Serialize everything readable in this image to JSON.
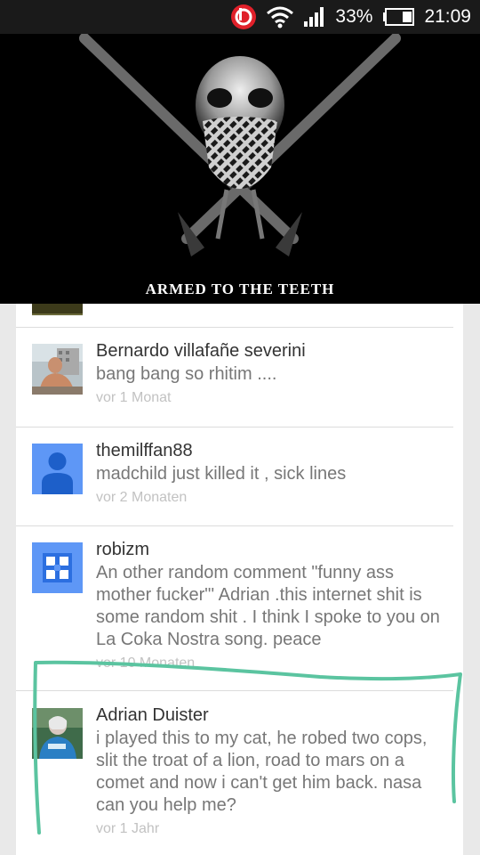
{
  "status_bar": {
    "battery": "33%",
    "time": "21:09",
    "icons": [
      "beats-icon",
      "wifi-icon",
      "signal-icon",
      "battery-icon"
    ]
  },
  "video": {
    "caption": "ARMED TO THE TEETH"
  },
  "comments": [
    {
      "author": "Bernardo villafañe severini",
      "text": "bang bang so rhitim ....",
      "time": "vor 1 Monat"
    },
    {
      "author": "themilffan88",
      "text": "madchild just killed it , sick lines",
      "time": "vor 2 Monaten"
    },
    {
      "author": "robizm",
      "text_lines": [
        "An other random comment \"funny ass",
        "mother fucker\"' Adrian .this internet shit is",
        "some random shit . I think I spoke to you on",
        "La Coka Nostra song. peace"
      ],
      "time": "vor 10 Monaten"
    },
    {
      "author": "Adrian Duister",
      "text_lines": [
        "i played this to my cat, he robed two cops,",
        "slit the troat of a lion, road to mars on a",
        "comet and now i can't get him back. nasa",
        "can you help me?"
      ],
      "time": "vor 1 Jahr"
    }
  ],
  "colors": {
    "status_bar": "#1a1a1a",
    "beats_red": "#e0202a",
    "highlight_green": "#5bc4a0",
    "google_blue": "#5e97f6"
  }
}
